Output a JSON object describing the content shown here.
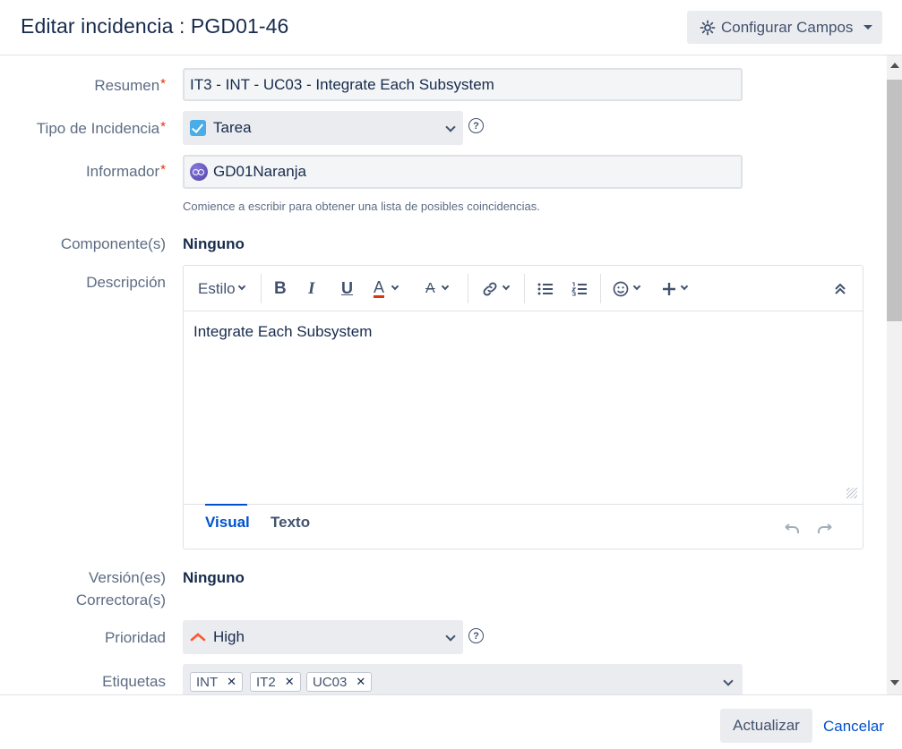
{
  "header": {
    "title": "Editar incidencia : PGD01-46",
    "configure_label": "Configurar Campos"
  },
  "form": {
    "summary": {
      "label": "Resumen",
      "required_mark": "*",
      "value": "IT3 - INT - UC03 - Integrate Each Subsystem"
    },
    "issue_type": {
      "label": "Tipo de Incidencia",
      "required_mark": "*",
      "value": "Tarea",
      "help": "?"
    },
    "reporter": {
      "label": "Informador",
      "required_mark": "*",
      "value": "GD01Naranja",
      "hint": "Comience a escribir para obtener una lista de posibles coincidencias."
    },
    "components": {
      "label": "Componente(s)",
      "value": "Ninguno"
    },
    "description": {
      "label": "Descripción",
      "style_label": "Estilo",
      "text": "Integrate Each Subsystem",
      "tabs": [
        "Visual",
        "Texto"
      ]
    },
    "fix_versions": {
      "label_line1": "Versión(es)",
      "label_line2": "Correctora(s)",
      "value": "Ninguno"
    },
    "priority": {
      "label": "Prioridad",
      "value": "High",
      "help": "?"
    },
    "labels": {
      "label": "Etiquetas",
      "tags": [
        "INT",
        "IT2",
        "UC03"
      ]
    }
  },
  "footer": {
    "update_label": "Actualizar",
    "cancel_label": "Cancelar"
  },
  "colors": {
    "primary": "#0052cc",
    "required": "#de350b",
    "priority_high": "#ff5630"
  }
}
